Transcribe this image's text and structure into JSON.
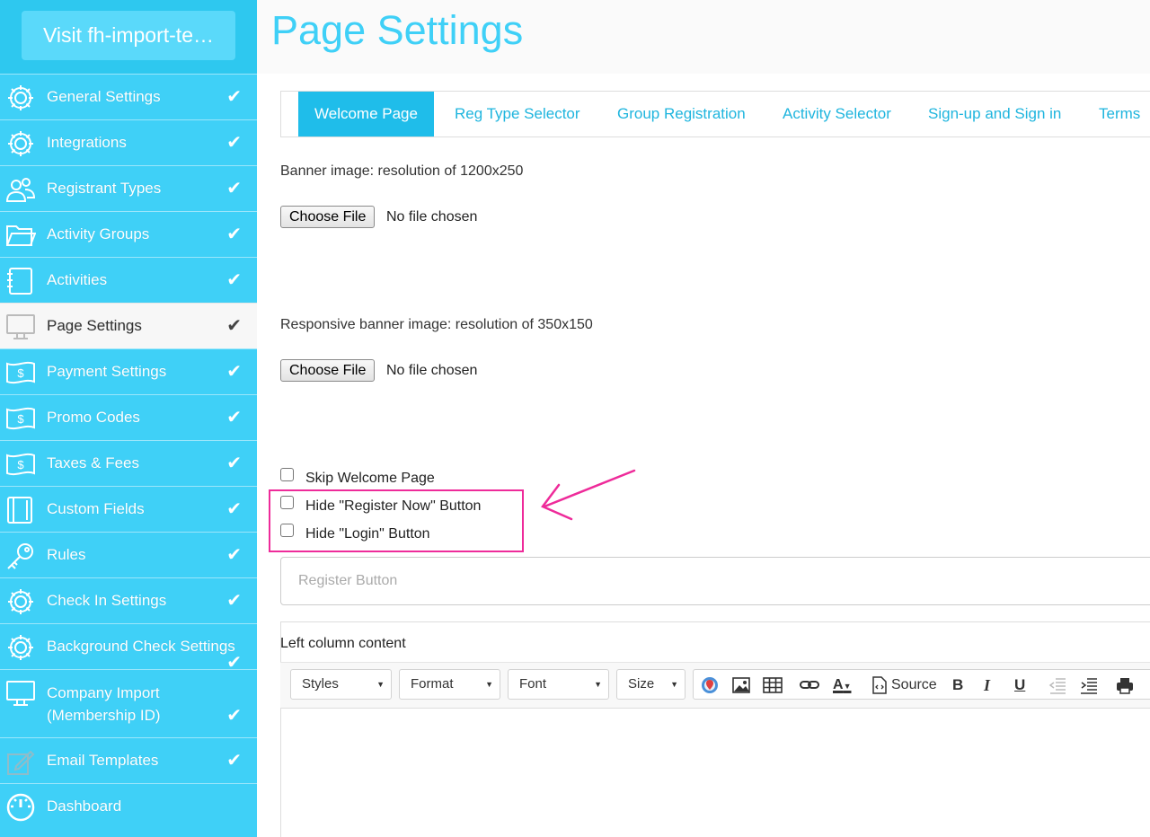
{
  "sidebar": {
    "visit_label": "Visit fh-import-te…",
    "items": [
      {
        "label": "General Settings",
        "icon": "gear-icon"
      },
      {
        "label": "Integrations",
        "icon": "gear-icon"
      },
      {
        "label": "Registrant Types",
        "icon": "users-icon"
      },
      {
        "label": "Activity Groups",
        "icon": "folder-icon"
      },
      {
        "label": "Activities",
        "icon": "notebook-icon"
      },
      {
        "label": "Page Settings",
        "icon": "monitor-icon"
      },
      {
        "label": "Payment Settings",
        "icon": "money-icon"
      },
      {
        "label": "Promo Codes",
        "icon": "money-icon"
      },
      {
        "label": "Taxes & Fees",
        "icon": "money-icon"
      },
      {
        "label": "Custom Fields",
        "icon": "notebook-icon"
      },
      {
        "label": "Rules",
        "icon": "key-icon"
      },
      {
        "label": "Check In Settings",
        "icon": "gear-icon"
      },
      {
        "label": "Background Check Settings",
        "icon": "gear-icon"
      },
      {
        "label_line1": "Company Import",
        "label_line2": "(Membership ID)",
        "icon": "monitor-icon"
      },
      {
        "label": "Email Templates",
        "icon": "edit-icon"
      },
      {
        "label": "Dashboard",
        "icon": "gauge-icon"
      }
    ],
    "check_glyph": "✔"
  },
  "page": {
    "title": "Page Settings"
  },
  "tabs": [
    "Welcome Page",
    "Reg Type Selector",
    "Group Registration",
    "Activity Selector",
    "Sign-up and Sign in",
    "Terms"
  ],
  "banner": {
    "label": "Banner image: resolution of 1200x250",
    "button": "Choose File",
    "status": "No file chosen"
  },
  "responsive_banner": {
    "label": "Responsive banner image: resolution of 350x150",
    "button": "Choose File",
    "status": "No file chosen"
  },
  "options": {
    "skip": "Skip Welcome Page",
    "hide_register": "Hide \"Register Now\" Button",
    "hide_login": "Hide \"Login\" Button"
  },
  "register_button": {
    "placeholder": "Register Button"
  },
  "editor": {
    "label": "Left column content",
    "styles": "Styles",
    "format": "Format",
    "font": "Font",
    "size": "Size",
    "source": "Source",
    "bold": "B",
    "italic": "I",
    "underline": "U"
  },
  "colors": {
    "sidebar": "#3fd0f7",
    "accent": "#1fbdea",
    "highlight": "#ee2b9a"
  }
}
